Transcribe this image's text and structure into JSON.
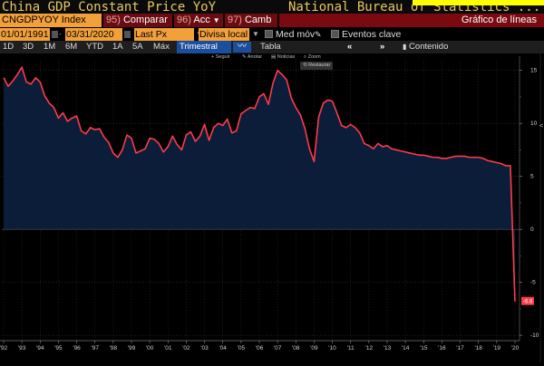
{
  "title": {
    "left": "China GDP Constant Price YoY",
    "right": "National Bureau of Statistics ..."
  },
  "toolbar": {
    "ticker": "CNGDPYOY Index",
    "comparar_num": "95)",
    "comparar": "Comparar",
    "acc_num": "96)",
    "acc": "Acc",
    "camb_num": "97)",
    "camb": "Camb",
    "chart_type": "Gráfico de líneas"
  },
  "filters": {
    "start_date": "01/01/1991",
    "end_date": "03/31/2020",
    "field": "Last Px",
    "currency": "Divisa local",
    "moving_avg": "Med móv",
    "key_events": "Eventos clave"
  },
  "ranges": [
    "1D",
    "3D",
    "1M",
    "6M",
    "YTD",
    "1A",
    "5A",
    "Máx"
  ],
  "period": "Trimestral",
  "table_label": "Tabla",
  "content_label": "Contenido",
  "chart_tools": {
    "seguir": "Seguir",
    "anotar": "Anotar",
    "noticias": "Noticias",
    "zoom": "Zoom",
    "restaurar": "Restaurar"
  },
  "colors": {
    "line": "#ff3b4a",
    "fill": "#0c1d3a",
    "ticker_bg": "#f2a03a",
    "button_bg": "#6b0d10",
    "selected_bg": "#1b4f9e",
    "title_text": "#e8c860",
    "last_value_bg": "#ff3b4a"
  },
  "chart_data": {
    "type": "area",
    "title": "China GDP Constant Price YoY",
    "ylim": [
      -10.5,
      16
    ],
    "yticks": [
      15,
      10,
      5,
      0,
      -5,
      -10
    ],
    "xlim": [
      1991.9,
      2020.25
    ],
    "xticks": [
      "'92",
      "'93",
      "'94",
      "'95",
      "'96",
      "'97",
      "'98",
      "'99",
      "'00",
      "'01",
      "'02",
      "'03",
      "'04",
      "'05",
      "'06",
      "'07",
      "'08",
      "'09",
      "'10",
      "'11",
      "'12",
      "'13",
      "'14",
      "'15",
      "'16",
      "'17",
      "'18",
      "'19",
      "'20"
    ],
    "last_value_label": "-6.8",
    "series": [
      {
        "x": [
          1992.0,
          1992.25,
          1992.5,
          1992.75,
          1993.0,
          1993.25,
          1993.5,
          1993.75,
          1994.0,
          1994.25,
          1994.5,
          1994.75,
          1995.0,
          1995.25,
          1995.5,
          1995.75,
          1996.0,
          1996.25,
          1996.5,
          1996.75,
          1997.0,
          1997.25,
          1997.5,
          1997.75,
          1998.0,
          1998.25,
          1998.5,
          1998.75,
          1999.0,
          1999.25,
          1999.5,
          1999.75,
          2000.0,
          2000.25,
          2000.5,
          2000.75,
          2001.0,
          2001.25,
          2001.5,
          2001.75,
          2002.0,
          2002.25,
          2002.5,
          2002.75,
          2003.0,
          2003.25,
          2003.5,
          2003.75,
          2004.0,
          2004.25,
          2004.5,
          2004.75,
          2005.0,
          2005.25,
          2005.5,
          2005.75,
          2006.0,
          2006.25,
          2006.5,
          2006.75,
          2007.0,
          2007.25,
          2007.5,
          2007.75,
          2008.0,
          2008.25,
          2008.5,
          2008.75,
          2009.0,
          2009.25,
          2009.5,
          2009.75,
          2010.0,
          2010.25,
          2010.5,
          2010.75,
          2011.0,
          2011.25,
          2011.5,
          2011.75,
          2012.0,
          2012.25,
          2012.5,
          2012.75,
          2013.0,
          2013.25,
          2013.5,
          2013.75,
          2014.0,
          2014.25,
          2014.5,
          2014.75,
          2015.0,
          2015.25,
          2015.5,
          2015.75,
          2016.0,
          2016.25,
          2016.5,
          2016.75,
          2017.0,
          2017.25,
          2017.5,
          2017.75,
          2018.0,
          2018.25,
          2018.5,
          2018.75,
          2019.0,
          2019.25,
          2019.5,
          2019.75,
          2020.0
        ],
        "y": [
          14.3,
          13.5,
          14.0,
          14.6,
          15.3,
          13.9,
          13.7,
          14.3,
          13.9,
          12.6,
          11.9,
          11.5,
          10.5,
          11.0,
          10.2,
          10.5,
          10.7,
          9.3,
          9.0,
          9.6,
          9.4,
          9.5,
          8.7,
          8.2,
          7.2,
          6.8,
          7.5,
          8.9,
          8.6,
          7.2,
          7.4,
          7.6,
          8.6,
          8.5,
          8.1,
          7.3,
          7.8,
          8.8,
          8.0,
          7.5,
          8.9,
          9.2,
          8.3,
          8.8,
          9.9,
          8.4,
          9.6,
          10.0,
          9.8,
          10.4,
          9.1,
          9.3,
          10.9,
          11.2,
          11.5,
          11.4,
          12.5,
          12.8,
          11.8,
          13.8,
          15.0,
          14.6,
          14.1,
          12.4,
          11.5,
          10.8,
          9.5,
          7.6,
          6.4,
          10.6,
          11.9,
          12.2,
          12.1,
          11.0,
          9.8,
          9.6,
          9.9,
          9.6,
          9.1,
          8.1,
          7.9,
          7.6,
          8.1,
          7.8,
          7.9,
          7.6,
          7.5,
          7.4,
          7.3,
          7.2,
          7.1,
          7.0,
          7.0,
          6.9,
          6.8,
          6.8,
          6.7,
          6.7,
          6.8,
          6.9,
          6.9,
          6.9,
          6.8,
          6.8,
          6.8,
          6.7,
          6.5,
          6.4,
          6.3,
          6.2,
          6.0,
          6.0,
          -6.8
        ]
      }
    ]
  }
}
